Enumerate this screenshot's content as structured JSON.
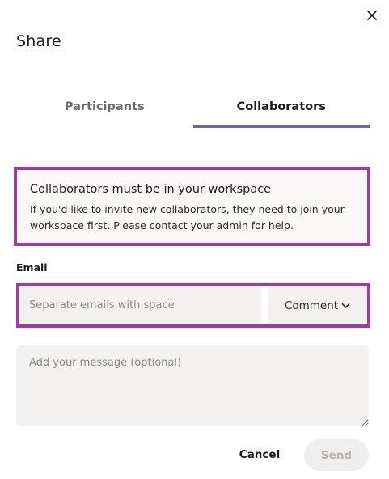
{
  "dialog": {
    "title": "Share",
    "close_icon": "close-icon"
  },
  "tabs": [
    {
      "label": "Participants",
      "active": false
    },
    {
      "label": "Collaborators",
      "active": true
    }
  ],
  "notice": {
    "title": "Collaborators must be in your workspace",
    "body": "If you'd like to invite new collaborators, they need to join your workspace first. Please contact your admin for help."
  },
  "email": {
    "label": "Email",
    "value": "",
    "placeholder": "Separate emails with space",
    "permission": "Comment",
    "permission_icon": "chevron-down-icon"
  },
  "message": {
    "value": "",
    "placeholder": "Add your message (optional)"
  },
  "actions": {
    "cancel_label": "Cancel",
    "send_label": "Send"
  },
  "colors": {
    "tab_indicator": "#6c64b0",
    "highlight_border": "#9a3f9e",
    "field_background": "#f3f2f0",
    "send_disabled_text": "#b5b3b0"
  }
}
